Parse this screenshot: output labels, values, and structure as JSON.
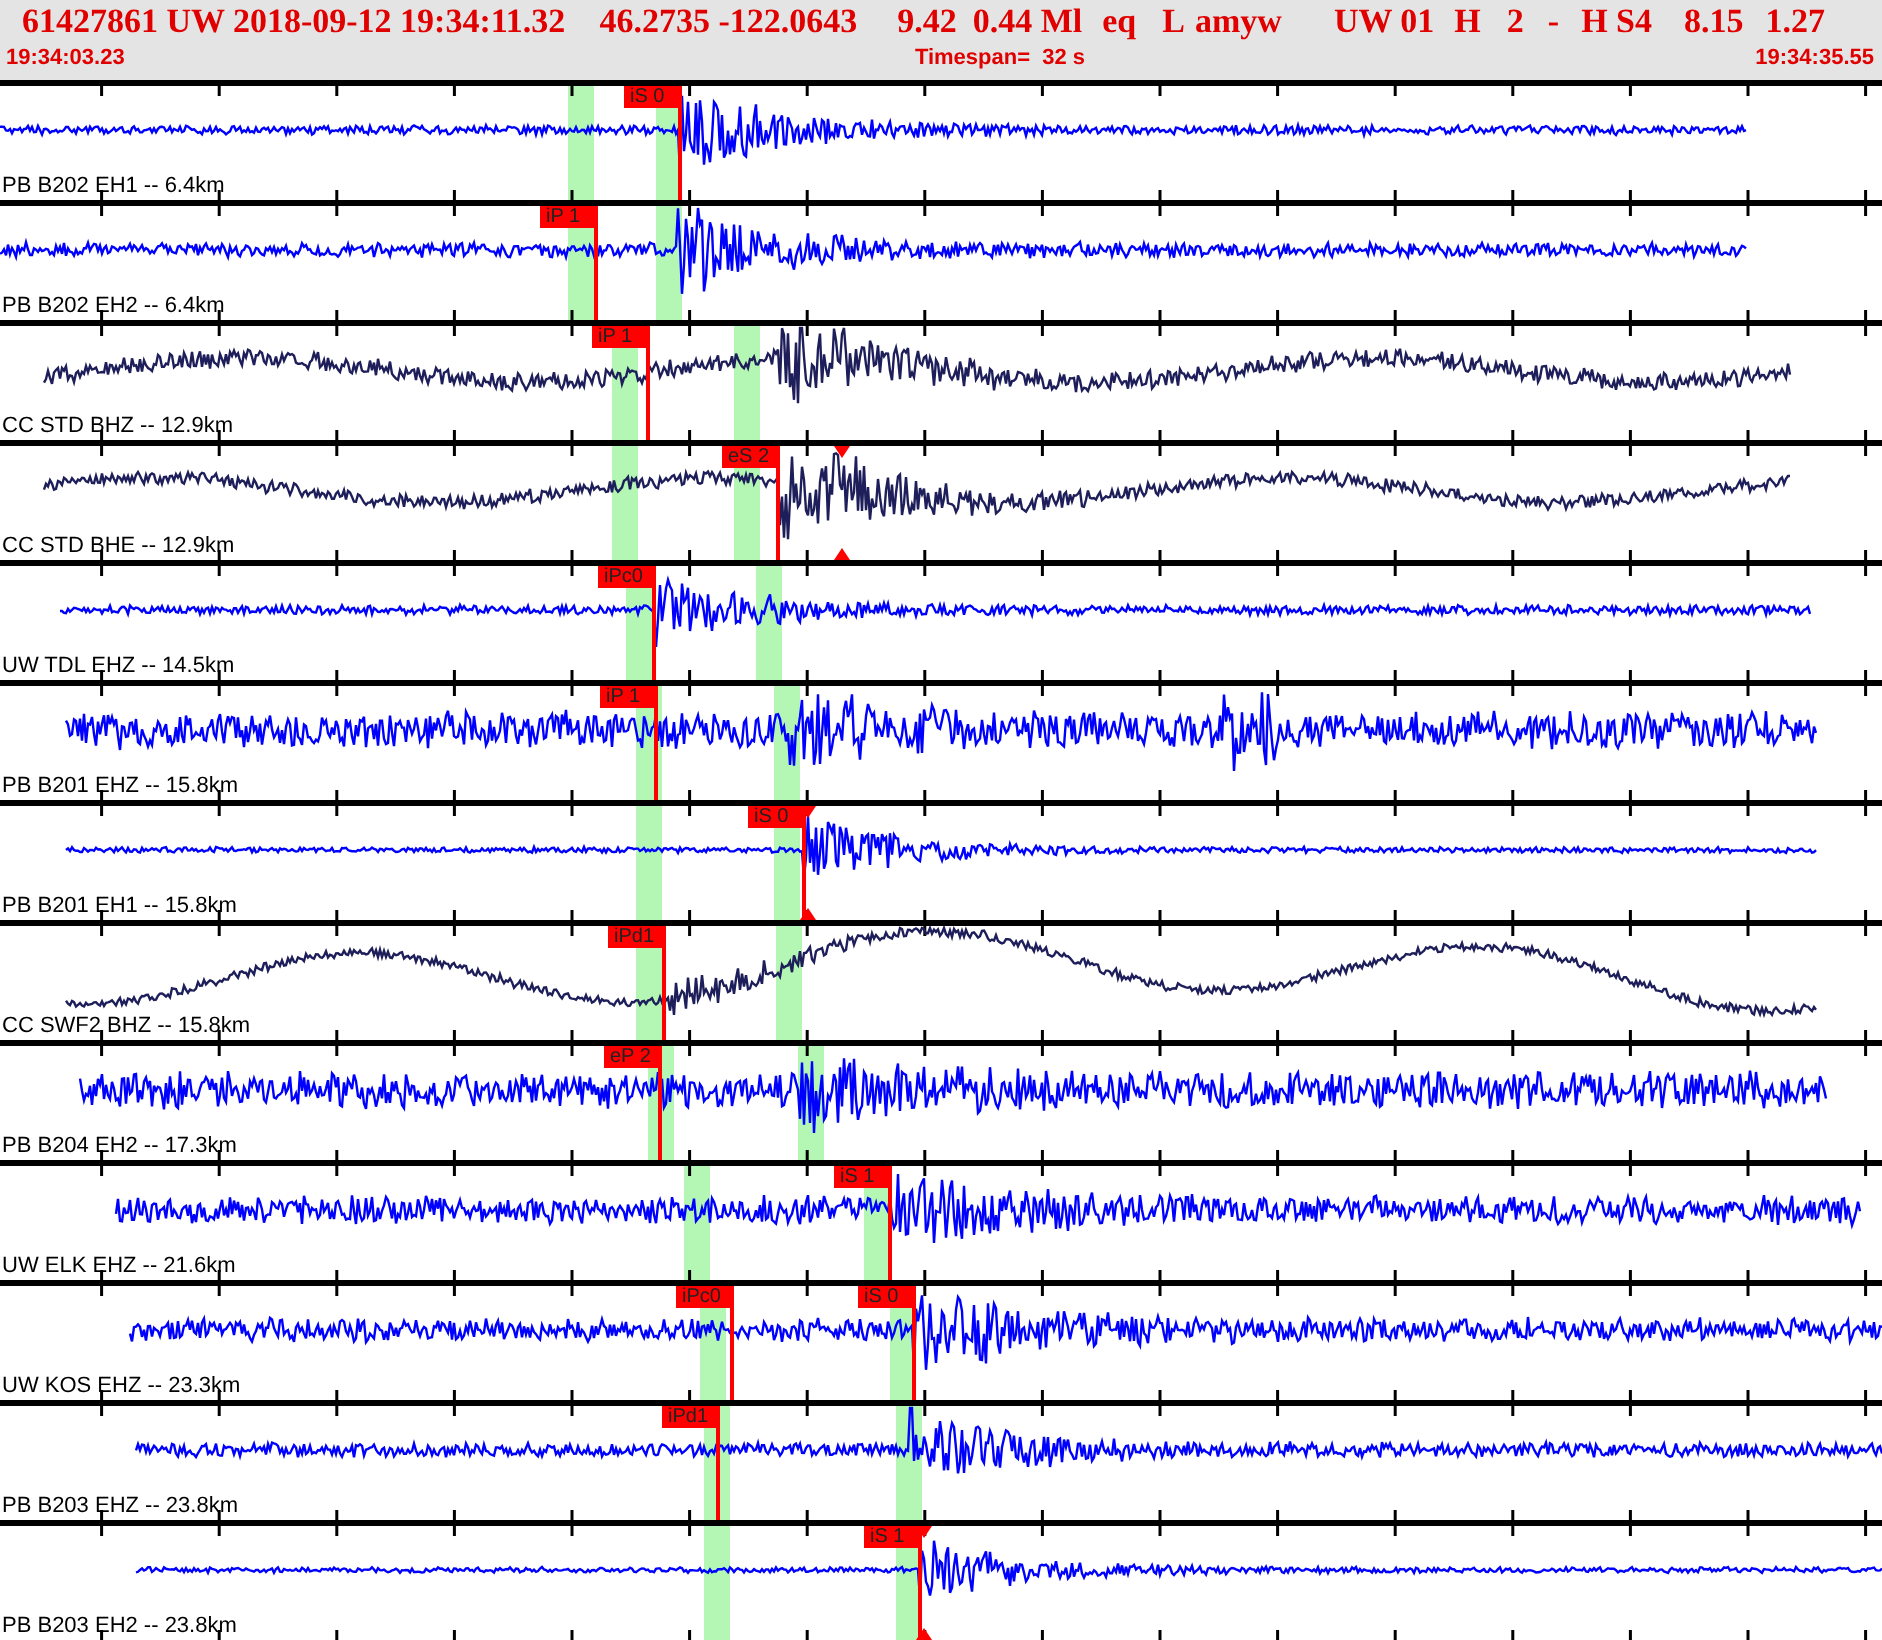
{
  "header": {
    "fields": [
      "61427861 UW 2018-09-12 19:34:11.32",
      "46.2735 -122.0643",
      "9.42",
      "0.44 Ml",
      "eq",
      "L",
      "amyw",
      "UW 01",
      "H",
      "2",
      "-",
      "H S4",
      "8.15",
      "1.27"
    ],
    "start_time": "19:34:03.23",
    "timespan": "Timespan=  32 s",
    "end_time": "19:34:35.55"
  },
  "traces": [
    {
      "label": "PB B202 EH1 -- 6.4km",
      "color": "#0000ff",
      "picks": [
        {
          "label": "iS 0"
        }
      ]
    },
    {
      "label": "PB B202 EH2 -- 6.4km",
      "color": "#0000ff",
      "picks": [
        {
          "label": "iP 1"
        }
      ]
    },
    {
      "label": "CC STD BHZ -- 12.9km",
      "color": "#1e1e5a",
      "picks": [
        {
          "label": "iP 1"
        }
      ]
    },
    {
      "label": "CC STD BHE -- 12.9km",
      "color": "#1e1e5a",
      "picks": [
        {
          "label": "eS 2"
        }
      ]
    },
    {
      "label": "UW TDL EHZ -- 14.5km",
      "color": "#0000ff",
      "picks": [
        {
          "label": "iPc0"
        }
      ]
    },
    {
      "label": "PB B201 EHZ -- 15.8km",
      "color": "#0000ff",
      "picks": [
        {
          "label": "iP 1"
        }
      ]
    },
    {
      "label": "PB B201 EH1 -- 15.8km",
      "color": "#0000ff",
      "picks": [
        {
          "label": "iS 0"
        }
      ]
    },
    {
      "label": "CC SWF2 BHZ -- 15.8km",
      "color": "#1e1e5a",
      "picks": [
        {
          "label": "iPd1"
        }
      ]
    },
    {
      "label": "PB B204 EH2 -- 17.3km",
      "color": "#0000ff",
      "picks": [
        {
          "label": "eP 2"
        }
      ]
    },
    {
      "label": "UW ELK EHZ -- 21.6km",
      "color": "#0000ff",
      "picks": [
        {
          "label": "iS 1"
        }
      ]
    },
    {
      "label": "UW KOS EHZ -- 23.3km",
      "color": "#0000ff",
      "picks": [
        {
          "label": "iPc0"
        },
        {
          "label": "iS 0"
        }
      ]
    },
    {
      "label": "PB B203 EHZ -- 23.8km",
      "color": "#0000ff",
      "picks": [
        {
          "label": "iPd1"
        }
      ]
    },
    {
      "label": "PB B203 EH2 -- 23.8km",
      "color": "#0000ff",
      "picks": [
        {
          "label": "iS 1"
        }
      ]
    }
  ]
}
